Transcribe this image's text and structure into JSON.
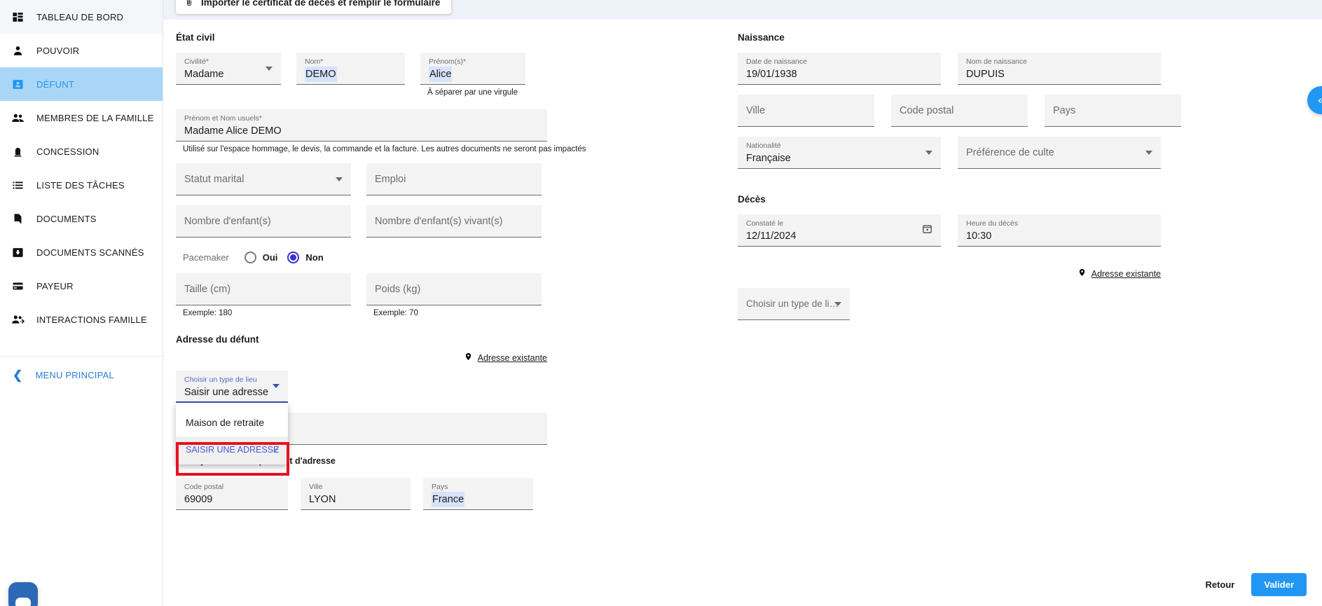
{
  "sidebar": {
    "items": [
      {
        "label": "TABLEAU DE BORD",
        "icon": "dashboard-icon",
        "active": false
      },
      {
        "label": "POUVOIR",
        "icon": "person-icon",
        "active": false
      },
      {
        "label": "DÉFUNT",
        "icon": "badge-person-icon",
        "active": true
      },
      {
        "label": "MEMBRES DE LA FAMILLE",
        "icon": "people-icon",
        "active": false
      },
      {
        "label": "CONCESSION",
        "icon": "headstone-icon",
        "active": false
      },
      {
        "label": "LISTE DES TÂCHES",
        "icon": "list-icon",
        "active": false
      },
      {
        "label": "DOCUMENTS",
        "icon": "document-icon",
        "active": false
      },
      {
        "label": "DOCUMENTS SCANNÉS",
        "icon": "scan-download-icon",
        "active": false
      },
      {
        "label": "PAYEUR",
        "icon": "credit-card-icon",
        "active": false
      },
      {
        "label": "INTERACTIONS FAMILLE",
        "icon": "people-arrow-icon",
        "active": false
      }
    ],
    "main_menu_label": "MENU PRINCIPAL",
    "main_menu_icon": "chevron-left-icon",
    "chat_icon": "chat-bubble-icon"
  },
  "topbar": {
    "import_label": "Importer le certificat de décès et remplir le formulaire",
    "import_icon": "paperclip-icon"
  },
  "etat_civil": {
    "title": "État civil",
    "civilite": {
      "label": "Civilité*",
      "value": "Madame",
      "icon": "chevron-down-icon"
    },
    "nom": {
      "label": "Nom*",
      "value": "DEMO"
    },
    "prenoms": {
      "label": "Prénom(s)*",
      "value": "Alice",
      "hint": "À séparer par une virgule"
    },
    "prenom_nom_usuels": {
      "label": "Prénom et Nom usuels*",
      "value": "Madame Alice DEMO",
      "hint": "Utilisé sur l'espace hommage, le devis, la commande et la facture. Les autres documents ne seront pas impactés"
    },
    "statut_marital": {
      "placeholder": "Statut marital",
      "icon": "chevron-down-icon"
    },
    "emploi": {
      "placeholder": "Emploi"
    },
    "nombre_enfants": {
      "placeholder": "Nombre d'enfant(s)"
    },
    "nombre_enfants_vivants": {
      "placeholder": "Nombre d'enfant(s) vivant(s)"
    },
    "pacemaker": {
      "label": "Pacemaker",
      "options": [
        "Oui",
        "Non"
      ],
      "selected": "Non"
    },
    "taille": {
      "placeholder": "Taille (cm)",
      "hint": "Exemple: 180"
    },
    "poids": {
      "placeholder": "Poids (kg)",
      "hint": "Exemple: 70"
    }
  },
  "adresse_defunt": {
    "title": "Adresse du défunt",
    "existing_address_link": "Adresse existante",
    "existing_address_icon": "map-pin-icon",
    "type_lieu": {
      "label": "Choisir un type de lieu",
      "value": "Saisir une adresse",
      "icon": "chevron-down-icon",
      "options": [
        {
          "label": "Maison de retraite",
          "selected": false
        },
        {
          "label": "Saisir une adresse",
          "selected": true,
          "check_icon": "check-icon"
        }
      ]
    },
    "add_complement": {
      "label": "Ajouter un complément d'adresse",
      "icon": "plus-icon"
    },
    "code_postal": {
      "label": "Code postal",
      "value": "69009"
    },
    "ville": {
      "label": "Ville",
      "value": "LYON"
    },
    "pays": {
      "label": "Pays",
      "value": "France"
    }
  },
  "naissance": {
    "title": "Naissance",
    "date_naissance": {
      "label": "Date de naissance",
      "value": "19/01/1938"
    },
    "nom_naissance": {
      "label": "Nom de naissance",
      "value": "DUPUIS"
    },
    "ville": {
      "placeholder": "Ville"
    },
    "code_postal": {
      "placeholder": "Code postal"
    },
    "pays": {
      "placeholder": "Pays"
    },
    "nationalite": {
      "label": "Nationalité",
      "value": "Française",
      "icon": "chevron-down-icon"
    },
    "preference_culte": {
      "placeholder": "Préférence de culte",
      "icon": "chevron-down-icon"
    }
  },
  "deces": {
    "title": "Décès",
    "constate_le": {
      "label": "Constaté le",
      "value": "12/11/2024",
      "icon": "calendar-icon"
    },
    "heure_deces": {
      "label": "Heure du décès",
      "value": "10:30"
    },
    "existing_address_link": "Adresse existante",
    "existing_address_icon": "map-pin-icon",
    "type_lieu": {
      "placeholder": "Choisir un type de li…",
      "icon": "chevron-down-icon"
    }
  },
  "edge_toggle": {
    "icon": "double-chevron-left-icon",
    "glyph": "«"
  },
  "footer": {
    "back_label": "Retour",
    "validate_label": "Valider"
  },
  "colors": {
    "accent": "#2196f3",
    "active_nav_bg": "#a9d6f7",
    "highlight_box": "#e8111f",
    "selection": "#d6e3fb",
    "field_bg": "#f3f3f3",
    "focus": "#3a4fb8"
  }
}
